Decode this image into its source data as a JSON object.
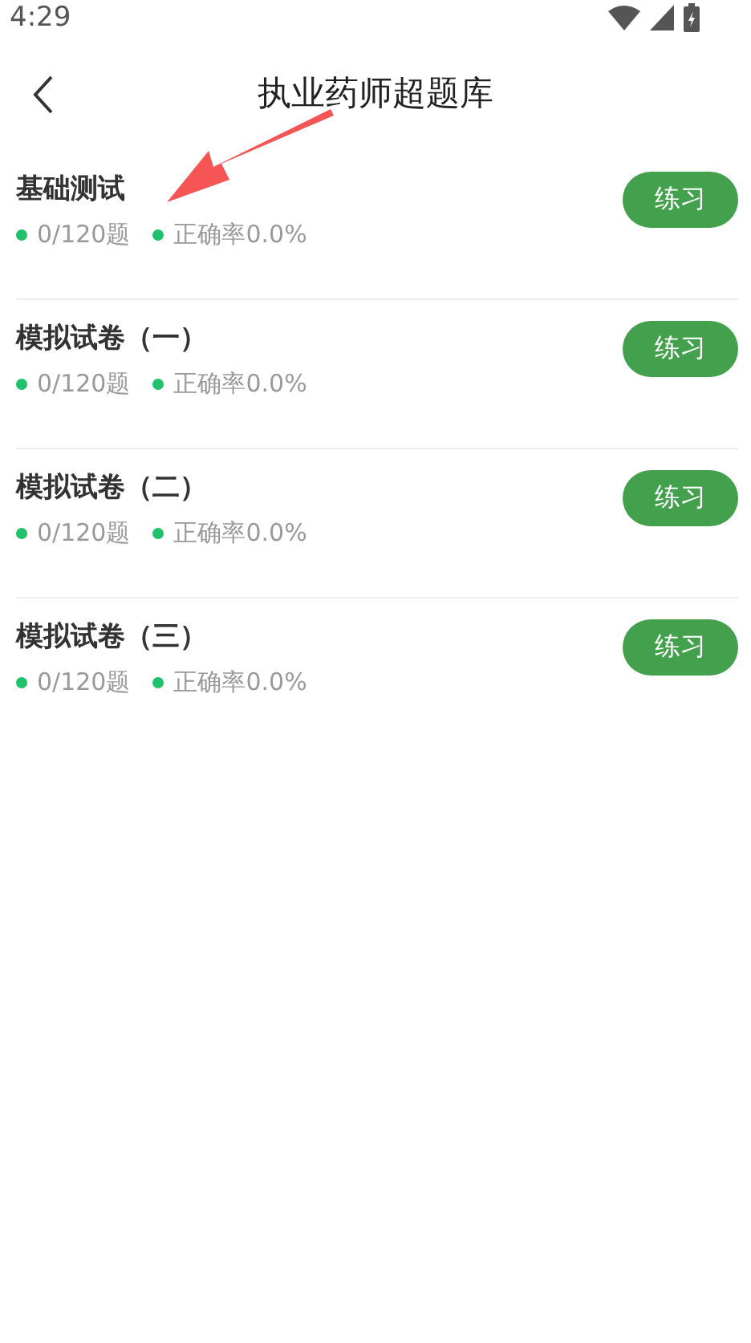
{
  "status_bar": {
    "time": "4:29"
  },
  "header": {
    "title": "执业药师超题库"
  },
  "items": [
    {
      "title": "基础测试",
      "count": "0/120题",
      "accuracy": "正确率0.0%",
      "button": "练习"
    },
    {
      "title": "模拟试卷（一）",
      "count": "0/120题",
      "accuracy": "正确率0.0%",
      "button": "练习"
    },
    {
      "title": "模拟试卷（二）",
      "count": "0/120题",
      "accuracy": "正确率0.0%",
      "button": "练习"
    },
    {
      "title": "模拟试卷（三）",
      "count": "0/120题",
      "accuracy": "正确率0.0%",
      "button": "练习"
    }
  ]
}
